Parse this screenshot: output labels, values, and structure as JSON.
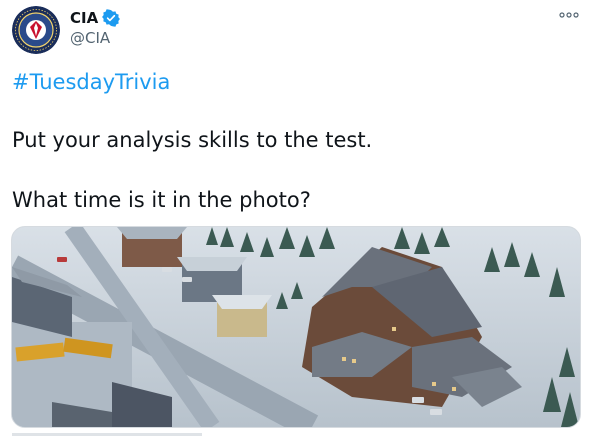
{
  "account": {
    "name": "CIA",
    "handle": "@CIA",
    "verified": true,
    "avatar_icon": "cia-seal-icon"
  },
  "tweet": {
    "hashtag": "#TuesdayTrivia",
    "line1": "Put your analysis skills to the test.",
    "line2": "What time is it in the photo?"
  },
  "colors": {
    "link": "#1d9bf0",
    "verified": "#1d9bf0",
    "text": "#0f1419",
    "secondary": "#536471"
  },
  "icons": {
    "more": "more-options-icon",
    "verified": "verified-badge-icon"
  }
}
